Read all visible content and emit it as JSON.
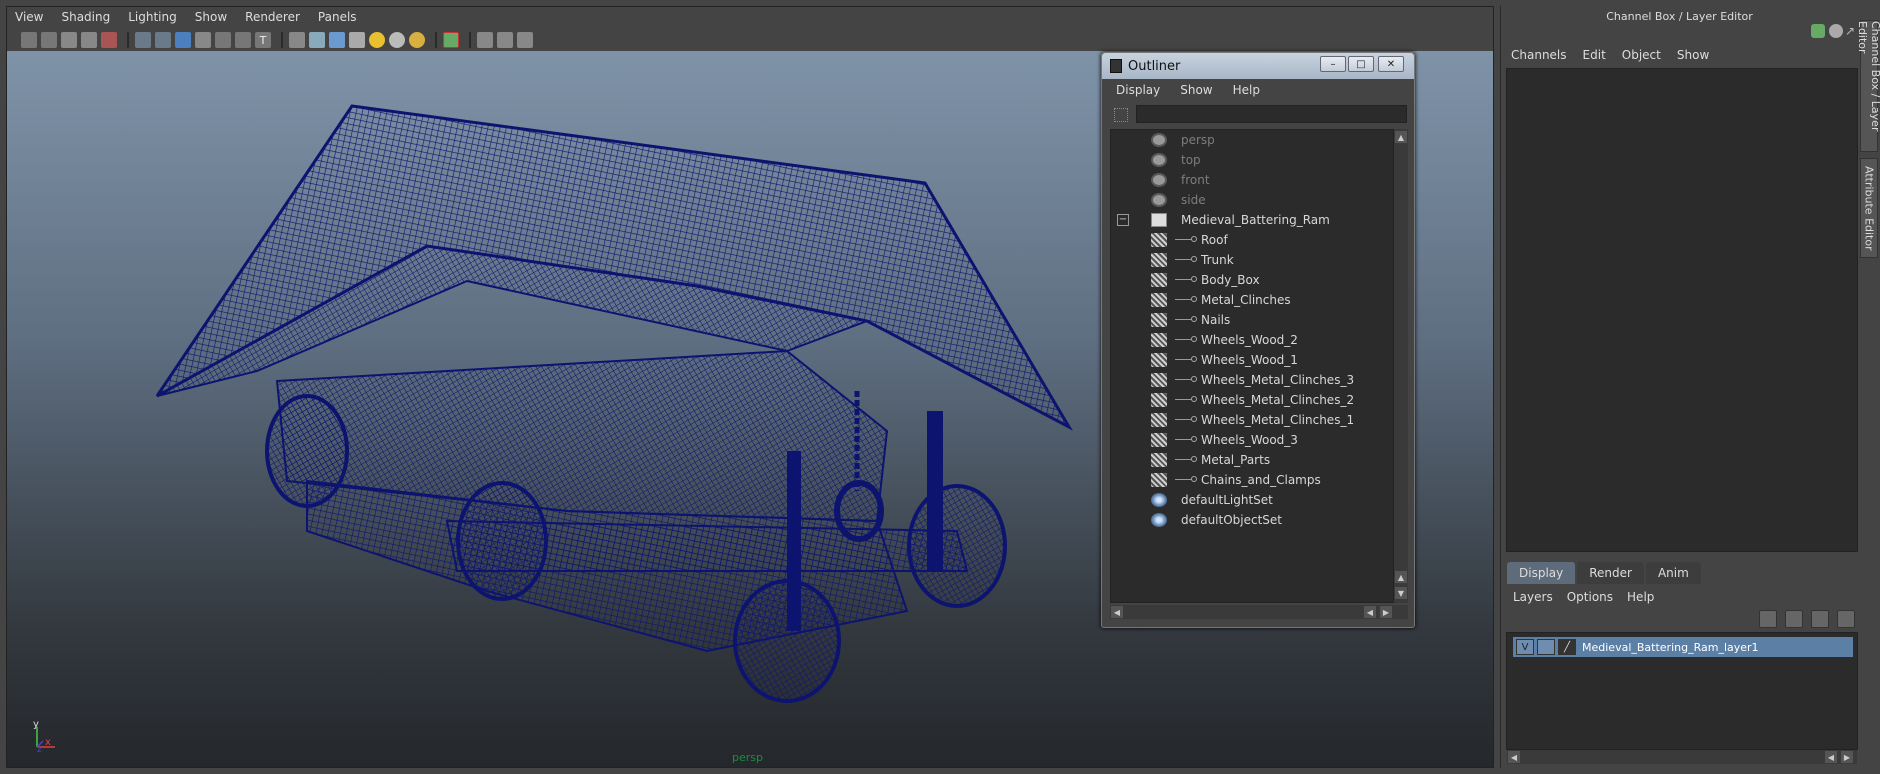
{
  "viewport": {
    "menu": [
      "View",
      "Shading",
      "Lighting",
      "Show",
      "Renderer",
      "Panels"
    ],
    "camera_label": "persp",
    "axis_labels": {
      "y": "y",
      "x": "x",
      "z": "z"
    }
  },
  "outliner": {
    "title": "Outliner",
    "menu": [
      "Display",
      "Show",
      "Help"
    ],
    "items": [
      {
        "label": "persp",
        "icon": "camera-icon",
        "dim": true,
        "indent": 0
      },
      {
        "label": "top",
        "icon": "camera-icon",
        "dim": true,
        "indent": 0
      },
      {
        "label": "front",
        "icon": "camera-icon",
        "dim": true,
        "indent": 0
      },
      {
        "label": "side",
        "icon": "camera-icon",
        "dim": true,
        "indent": 0
      },
      {
        "label": "Medieval_Battering_Ram",
        "icon": "group-icon",
        "dim": false,
        "indent": 0
      },
      {
        "label": "Roof",
        "icon": "mesh-icon",
        "dim": false,
        "indent": 1
      },
      {
        "label": "Trunk",
        "icon": "mesh-icon",
        "dim": false,
        "indent": 1
      },
      {
        "label": "Body_Box",
        "icon": "mesh-icon",
        "dim": false,
        "indent": 1
      },
      {
        "label": "Metal_Clinches",
        "icon": "mesh-icon",
        "dim": false,
        "indent": 1
      },
      {
        "label": "Nails",
        "icon": "mesh-icon",
        "dim": false,
        "indent": 1
      },
      {
        "label": "Wheels_Wood_2",
        "icon": "mesh-icon",
        "dim": false,
        "indent": 1
      },
      {
        "label": "Wheels_Wood_1",
        "icon": "mesh-icon",
        "dim": false,
        "indent": 1
      },
      {
        "label": "Wheels_Metal_Clinches_3",
        "icon": "mesh-icon",
        "dim": false,
        "indent": 1
      },
      {
        "label": "Wheels_Metal_Clinches_2",
        "icon": "mesh-icon",
        "dim": false,
        "indent": 1
      },
      {
        "label": "Wheels_Metal_Clinches_1",
        "icon": "mesh-icon",
        "dim": false,
        "indent": 1
      },
      {
        "label": "Wheels_Wood_3",
        "icon": "mesh-icon",
        "dim": false,
        "indent": 1
      },
      {
        "label": "Metal_Parts",
        "icon": "mesh-icon",
        "dim": false,
        "indent": 1
      },
      {
        "label": "Chains_and_Clamps",
        "icon": "mesh-icon",
        "dim": false,
        "indent": 1
      },
      {
        "label": "defaultLightSet",
        "icon": "set-icon",
        "dim": false,
        "indent": 0
      },
      {
        "label": "defaultObjectSet",
        "icon": "set-icon",
        "dim": false,
        "indent": 0
      }
    ]
  },
  "right_panel": {
    "title": "Channel Box / Layer Editor",
    "menu": [
      "Channels",
      "Edit",
      "Object",
      "Show"
    ],
    "tabs": [
      "Display",
      "Render",
      "Anim"
    ],
    "layers_menu": [
      "Layers",
      "Options",
      "Help"
    ],
    "layer": {
      "visible": "V",
      "name": "Medieval_Battering_Ram_layer1"
    }
  },
  "side_tabs": [
    "Channel Box / Layer Editor",
    "Attribute Editor"
  ],
  "colors": {
    "wireframe": "#0d1470",
    "camera_label": "#1c8e3c",
    "selected_layer": "#5c7fa6"
  }
}
